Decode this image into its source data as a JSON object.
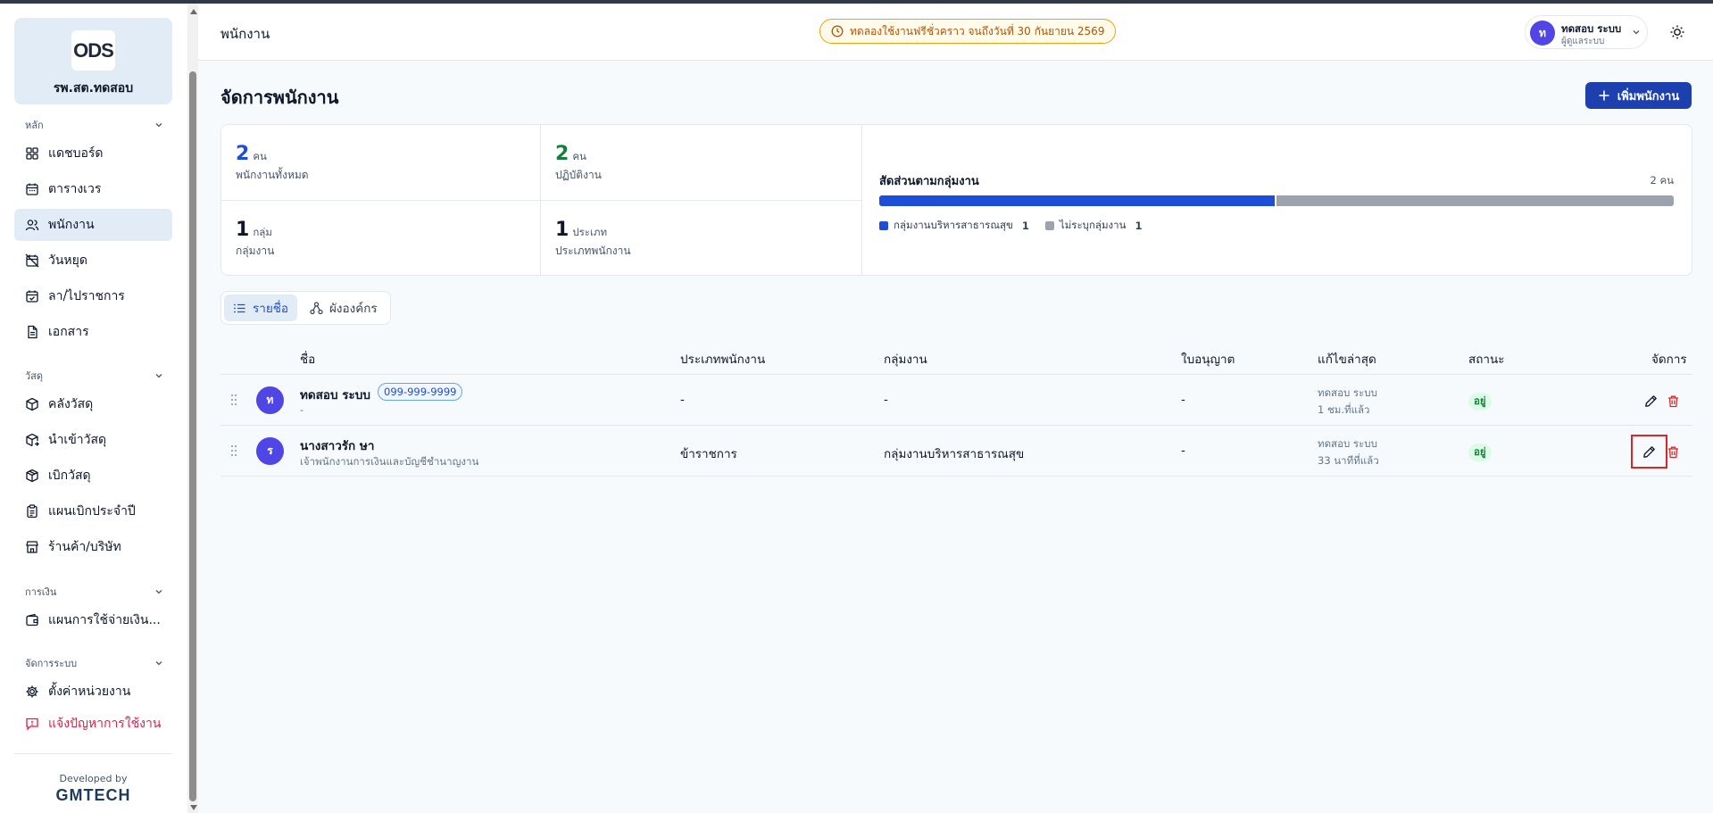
{
  "sidebar": {
    "org_logo": "ODS",
    "org_name": "รพ.สต.ทดสอบ",
    "sections": {
      "main": "หลัก",
      "supplies": "วัสดุ",
      "finance": "การเงิน",
      "system": "จัดการระบบ"
    },
    "items": [
      {
        "label": "แดชบอร์ด",
        "icon": "dashboard-icon"
      },
      {
        "label": "ตารางเวร",
        "icon": "calendar-icon"
      },
      {
        "label": "พนักงาน",
        "icon": "users-icon",
        "active": true
      },
      {
        "label": "วันหยุด",
        "icon": "calendar-off-icon"
      },
      {
        "label": "ลา/ไปราชการ",
        "icon": "calendar-check-icon"
      },
      {
        "label": "เอกสาร",
        "icon": "document-icon"
      },
      {
        "label": "คลังวัสดุ",
        "icon": "package-icon"
      },
      {
        "label": "นำเข้าวัสดุ",
        "icon": "package-in-icon"
      },
      {
        "label": "เบิกวัสดุ",
        "icon": "package-out-icon"
      },
      {
        "label": "แผนเบิกประจำปี",
        "icon": "clipboard-icon"
      },
      {
        "label": "ร้านค้า/บริษัท",
        "icon": "store-icon"
      },
      {
        "label": "แผนการใช้จ่ายเงิน...",
        "icon": "wallet-icon"
      },
      {
        "label": "ตั้งค่าหน่วยงาน",
        "icon": "gear-icon"
      },
      {
        "label": "แจ้งปัญหาการใช้งาน",
        "icon": "alert-message-icon"
      }
    ],
    "developed_by": "Developed by",
    "brand": "GMTECH"
  },
  "header": {
    "title": "พนักงาน",
    "trial_text": "ทดลองใช้งานฟรีชั่วคราว จนถึงวันที่ 30 กันยายน 2569",
    "user_initial": "ท",
    "user_name": "ทดสอบ ระบบ",
    "user_role": "ผู้ดูแลระบบ"
  },
  "page": {
    "title": "จัดการพนักงาน",
    "add_button": "เพิ่มพนักงาน"
  },
  "stats": {
    "total": {
      "value": "2",
      "unit": "คน",
      "label": "พนักงานทั้งหมด"
    },
    "active": {
      "value": "2",
      "unit": "คน",
      "label": "ปฏิบัติงาน"
    },
    "groups": {
      "value": "1",
      "unit": "กลุ่ม",
      "label": "กลุ่มงาน"
    },
    "types": {
      "value": "1",
      "unit": "ประเภท",
      "label": "ประเภทพนักงาน"
    },
    "ratio_title": "สัดส่วนตามกลุ่มงาน",
    "ratio_total": "2 คน",
    "ratio": [
      {
        "label": "กลุ่มงานบริหารสาธารณสุข",
        "count": "1",
        "value": 1,
        "color": "#1d4ed8"
      },
      {
        "label": "ไม่ระบุกลุ่มงาน",
        "count": "1",
        "value": 1,
        "color": "#9ca3af"
      }
    ]
  },
  "tabs": [
    {
      "label": "รายชื่อ",
      "active": true
    },
    {
      "label": "ผังองค์กร",
      "active": false
    }
  ],
  "table": {
    "columns": {
      "name": "ชื่อ",
      "type": "ประเภทพนักงาน",
      "group": "กลุ่มงาน",
      "license": "ใบอนุญาต",
      "edited": "แก้ไขล่าสุด",
      "status": "สถานะ",
      "actions": "จัดการ"
    },
    "rows": [
      {
        "initial": "ท",
        "name": "ทดสอบ ระบบ",
        "phone": "099-999-9999",
        "position": "-",
        "type": "-",
        "group": "-",
        "license": "-",
        "edited_by": "ทดสอบ ระบบ",
        "edited_ago": "1 ชม.ที่แล้ว",
        "status": "อยู่"
      },
      {
        "initial": "ร",
        "name": "นางสาวรัก ษา",
        "position": "เจ้าพนักงานการเงินและบัญชีชำนาญงาน",
        "type": "ข้าราชการ",
        "group": "กลุ่มงานบริหารสาธารณสุข",
        "license": "-",
        "edited_by": "ทดสอบ ระบบ",
        "edited_ago": "33 นาทีที่แล้ว",
        "status": "อยู่"
      }
    ]
  },
  "colors": {
    "accent": "#1e40af",
    "sidebar_active": "#e1ecf6",
    "status_ok": "#15803d",
    "danger": "#dc2626",
    "warning": "#b45309"
  }
}
